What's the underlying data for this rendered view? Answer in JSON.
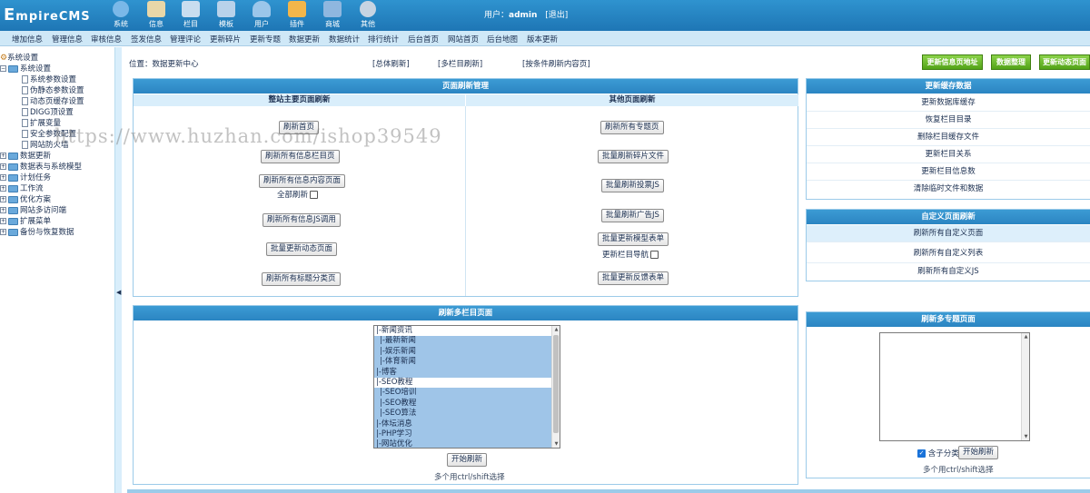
{
  "app": {
    "logo_text_big": "E",
    "logo_text": "mpireCMS",
    "user_label": "用户：",
    "user_name": "admin",
    "logout": "[退出]"
  },
  "top_nav": [
    {
      "label": "系统",
      "icon": "globe-icon",
      "color": "#7ab8e8"
    },
    {
      "label": "信息",
      "icon": "pencil-note-icon",
      "color": "#e8d7a8"
    },
    {
      "label": "栏目",
      "icon": "window-icon",
      "color": "#c9ddef"
    },
    {
      "label": "模板",
      "icon": "monitor-icon",
      "color": "#b9d2ea"
    },
    {
      "label": "用户",
      "icon": "user-icon",
      "color": "#9bc6ea"
    },
    {
      "label": "插件",
      "icon": "tools-icon",
      "color": "#f2b64a"
    },
    {
      "label": "商城",
      "icon": "shop-icon",
      "color": "#8fb7df"
    },
    {
      "label": "其他",
      "icon": "gear-icon",
      "color": "#c7d4e2"
    }
  ],
  "menu": [
    "增加信息",
    "管理信息",
    "审核信息",
    "签发信息",
    "管理评论",
    "更新碎片",
    "更新专题",
    "数据更新",
    "数据统计",
    "排行统计",
    "后台首页",
    "网站首页",
    "后台地图",
    "版本更新"
  ],
  "sidebar": {
    "items": [
      {
        "label": "系统设置",
        "type": "root"
      },
      {
        "label": "系统设置",
        "type": "folder-open"
      },
      {
        "label": "系统参数设置",
        "type": "page"
      },
      {
        "label": "伪静态参数设置",
        "type": "page"
      },
      {
        "label": "动态页缓存设置",
        "type": "page"
      },
      {
        "label": "DIGG顶设置",
        "type": "page"
      },
      {
        "label": "扩展变量",
        "type": "page"
      },
      {
        "label": "安全参数配置",
        "type": "page"
      },
      {
        "label": "网站防火墙",
        "type": "page"
      },
      {
        "label": "数据更新",
        "type": "folder"
      },
      {
        "label": "数据表与系统模型",
        "type": "folder"
      },
      {
        "label": "计划任务",
        "type": "folder"
      },
      {
        "label": "工作流",
        "type": "folder"
      },
      {
        "label": "优化方案",
        "type": "folder"
      },
      {
        "label": "网站多访问端",
        "type": "folder"
      },
      {
        "label": "扩展菜单",
        "type": "folder"
      },
      {
        "label": "备份与恢复数据",
        "type": "folder"
      }
    ]
  },
  "location": {
    "text": "位置：数据更新中心",
    "links": [
      "[总体刷新]",
      "[多栏目刷新]",
      "[按条件刷新内容页]"
    ]
  },
  "green_buttons": [
    "更新信息页地址",
    "数据整理",
    "更新动态页面"
  ],
  "page_refresh": {
    "title": "页面刷新管理",
    "left_head": "整站主要页面刷新",
    "right_head": "其他页面刷新",
    "left_buttons": [
      "刷新首页",
      "刷新所有信息栏目页",
      "刷新所有信息内容页面",
      "刷新所有信息JS调用",
      "批量更新动态页面",
      "刷新所有标题分类页"
    ],
    "all_refresh_label": "全部刷新",
    "right_buttons": [
      "刷新所有专题页",
      "批量刷新碎片文件",
      "批量刷新投票JS",
      "批量刷新广告JS",
      "批量更新模型表单",
      "批量更新反馈表单"
    ],
    "nav_label": "更新栏目导航"
  },
  "cache_panel": {
    "title": "更新缓存数据",
    "items": [
      "更新数据库缓存",
      "恢复栏目目录",
      "删除栏目缓存文件",
      "更新栏目关系",
      "更新栏目信息数",
      "清除临时文件和数据"
    ]
  },
  "custom_panel": {
    "title": "自定义页面刷新",
    "items": [
      "刷新所有自定义页面",
      "刷新所有自定义列表",
      "刷新所有自定义JS"
    ]
  },
  "multi_column": {
    "title": "刷新多栏目页面",
    "options": [
      {
        "label": "|-新闻资讯",
        "selected": false
      },
      {
        "label": "  |-最新新闻",
        "selected": true
      },
      {
        "label": "  |-娱乐新闻",
        "selected": true
      },
      {
        "label": "  |-体育新闻",
        "selected": true
      },
      {
        "label": "|-博客",
        "selected": true
      },
      {
        "label": "|-SEO教程",
        "selected": false
      },
      {
        "label": "  |-SEO培训",
        "selected": true
      },
      {
        "label": "  |-SEO教程",
        "selected": true
      },
      {
        "label": "  |-SEO算法",
        "selected": true
      },
      {
        "label": "|-体坛消息",
        "selected": true
      },
      {
        "label": "|-PHP学习",
        "selected": true
      },
      {
        "label": "|-网站优化",
        "selected": true
      }
    ],
    "start_button": "开始刷新",
    "hint": "多个用ctrl/shift选择"
  },
  "multi_topic": {
    "title": "刷新多专题页面",
    "include_sub_label": "含子分类",
    "start_button": "开始刷新",
    "hint": "多个用ctrl/shift选择"
  },
  "watermark": "https://www.huzhan.com/ishop39549"
}
